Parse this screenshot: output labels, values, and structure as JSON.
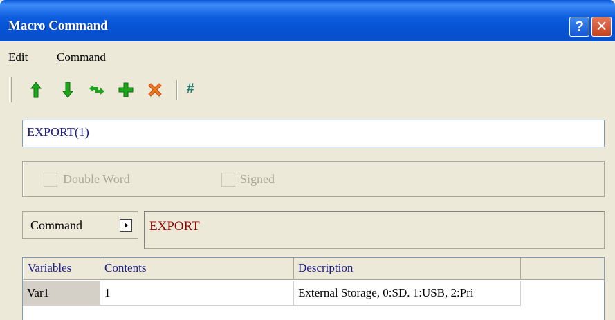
{
  "window": {
    "title": "Macro Command",
    "help_label": "?",
    "close_label": "✕"
  },
  "menu": {
    "items": [
      {
        "label": "Edit",
        "accel": "E",
        "rest": "dit"
      },
      {
        "label": "Command",
        "accel": "C",
        "rest": "ommand"
      }
    ]
  },
  "toolbar": {
    "buttons": [
      {
        "name": "move-up",
        "icon": "green-up-arrow-icon"
      },
      {
        "name": "move-down",
        "icon": "green-down-arrow-icon"
      },
      {
        "name": "replace",
        "icon": "swap-arrows-icon"
      },
      {
        "name": "add",
        "icon": "green-plus-icon"
      },
      {
        "name": "delete",
        "icon": "orange-x-icon"
      },
      {
        "name": "line-number",
        "icon": "hash-icon",
        "label": "#"
      }
    ]
  },
  "expression": {
    "value": "EXPORT(1)"
  },
  "options": {
    "double_word": "Double Word",
    "signed": "Signed"
  },
  "command": {
    "button_label": "Command",
    "selected": "EXPORT"
  },
  "table": {
    "columns": [
      "Variables",
      "Contents",
      "Description"
    ],
    "rows": [
      {
        "variable": "Var1",
        "contents": "1",
        "description": "External Storage, 0:SD. 1:USB, 2:Pri"
      }
    ]
  },
  "colors": {
    "title_bar": "#0552d3",
    "command_text": "#8b0000",
    "header_text": "#1a1a8a"
  }
}
